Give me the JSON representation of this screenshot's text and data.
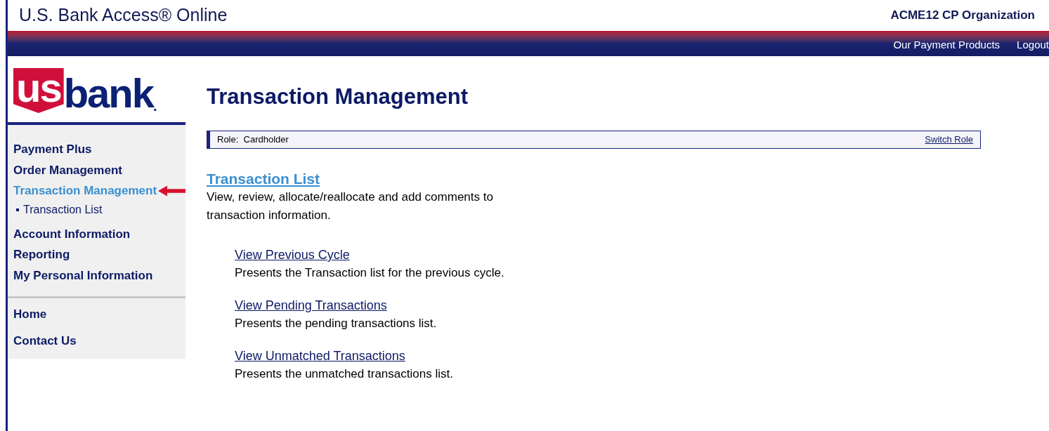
{
  "header": {
    "title": "U.S. Bank Access® Online",
    "organization": "ACME12 CP Organization"
  },
  "top_nav": [
    "Our Payment Products",
    "Logout"
  ],
  "logo": {
    "shield": "us",
    "word": "bank",
    "dot": "."
  },
  "sidebar": {
    "items": [
      {
        "label": "Payment Plus",
        "kind": "main",
        "selected": false
      },
      {
        "label": "Order Management",
        "kind": "main",
        "selected": false
      },
      {
        "label": "Transaction Management",
        "kind": "main",
        "selected": true
      },
      {
        "label": "Transaction List",
        "kind": "sub",
        "selected": false
      },
      {
        "label": "Account Information",
        "kind": "main",
        "selected": false
      },
      {
        "label": "Reporting",
        "kind": "main",
        "selected": false
      },
      {
        "label": "My Personal Information",
        "kind": "main",
        "selected": false
      }
    ],
    "footer_items": [
      "Home",
      "Contact Us"
    ]
  },
  "page_title": "Transaction Management",
  "role_bar": {
    "role": "Role:  Cardholder",
    "action": "Switch Role"
  },
  "section": {
    "title": "Transaction List",
    "description": "View, review, allocate/reallocate and add comments to transaction information.",
    "links": [
      {
        "title": "View Previous Cycle",
        "description": "Presents the Transaction list for the previous cycle."
      },
      {
        "title": "View Pending Transactions",
        "description": "Presents the pending transactions list."
      },
      {
        "title": "View Unmatched Transactions",
        "description": "Presents the unmatched transactions list."
      }
    ]
  }
}
